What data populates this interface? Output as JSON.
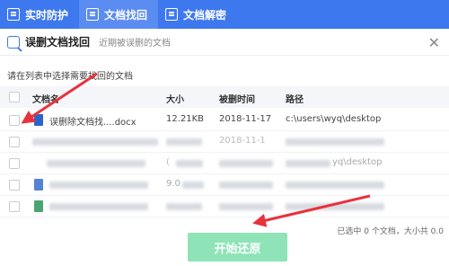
{
  "tabs": [
    {
      "label": "实时防护"
    },
    {
      "label": "文档找回"
    },
    {
      "label": "文档解密"
    }
  ],
  "header": {
    "title": "误删文档找回",
    "subtitle": "近期被误删的文档",
    "close_glyph": "✕"
  },
  "hint": "请在列表中选择需要找回的文档",
  "columns": {
    "name": "文档名",
    "size": "大小",
    "date": "被删时间",
    "path": "路径"
  },
  "rows": [
    {
      "name": "误删除文档找....docx",
      "size": "12.21KB",
      "date": "2018-11-17",
      "path": "c:\\users\\wyq\\desktop",
      "icon": "word-icon"
    },
    {
      "name": "",
      "size": "",
      "date": "2018-11-1",
      "path": "",
      "icon": "blurred"
    },
    {
      "name": "",
      "size": "(",
      "date": "",
      "path": "yq\\desktop",
      "icon": "blurred"
    },
    {
      "name": "",
      "size": "9.0",
      "date": "",
      "path": "",
      "icon": "word-icon"
    },
    {
      "name": "",
      "size": "",
      "date": "",
      "path": "",
      "icon": "excel-icon"
    }
  ],
  "status": "已选中 0 个文档，大小共 0.0",
  "restore_button": "开始还原",
  "colors": {
    "brand": "#3e78ee",
    "button": "#8ee4b7",
    "arrow": "#e8323c"
  }
}
